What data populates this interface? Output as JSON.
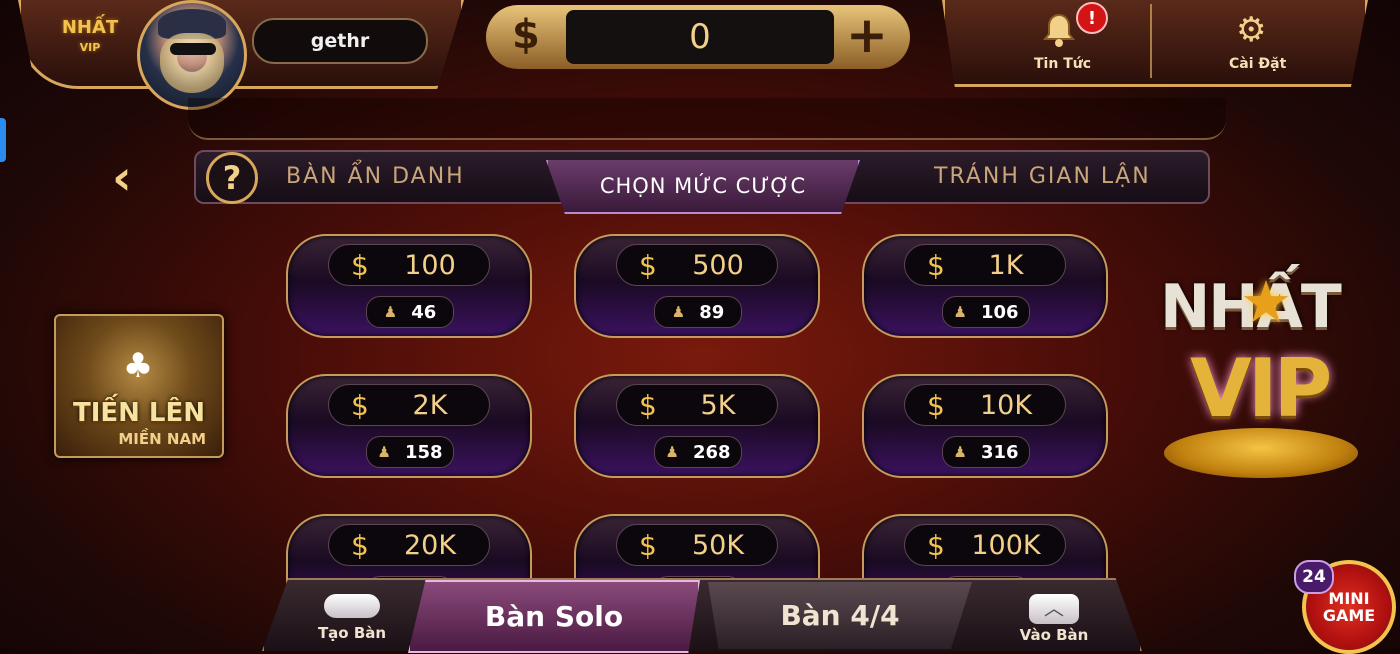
{
  "header": {
    "logo": {
      "line1": "NHẤT",
      "line2": "VIP"
    },
    "username": "gethr",
    "balance": "0",
    "currency_symbol": "$",
    "add_symbol": "+",
    "news": {
      "label": "Tin Tức",
      "badge": "!"
    },
    "settings": {
      "label": "Cài Đặt"
    }
  },
  "tabs": {
    "help_symbol": "?",
    "anonymous": "BÀN ẨN DANH",
    "choose_bet": "CHỌN MỨC CƯỢC",
    "anti_cheat": "TRÁNH GIAN LẬN"
  },
  "bets": [
    {
      "amount": "100",
      "players": "46"
    },
    {
      "amount": "500",
      "players": "89"
    },
    {
      "amount": "1K",
      "players": "106"
    },
    {
      "amount": "2K",
      "players": "158"
    },
    {
      "amount": "5K",
      "players": "268"
    },
    {
      "amount": "10K",
      "players": "316"
    },
    {
      "amount": "20K",
      "players": ""
    },
    {
      "amount": "50K",
      "players": ""
    },
    {
      "amount": "100K",
      "players": ""
    }
  ],
  "game_banner": {
    "title": "TIẾN LÊN",
    "subtitle": "MIỀN NAM"
  },
  "brand_badge": {
    "line1": "NHẤT",
    "line2": "VIP"
  },
  "bottom": {
    "create": "Tạo Bàn",
    "solo": "Bàn Solo",
    "four": "Bàn 4/4",
    "join": "Vào Bàn"
  },
  "minigame": {
    "label_line1": "MINI",
    "label_line2": "GAME",
    "count": "24"
  }
}
